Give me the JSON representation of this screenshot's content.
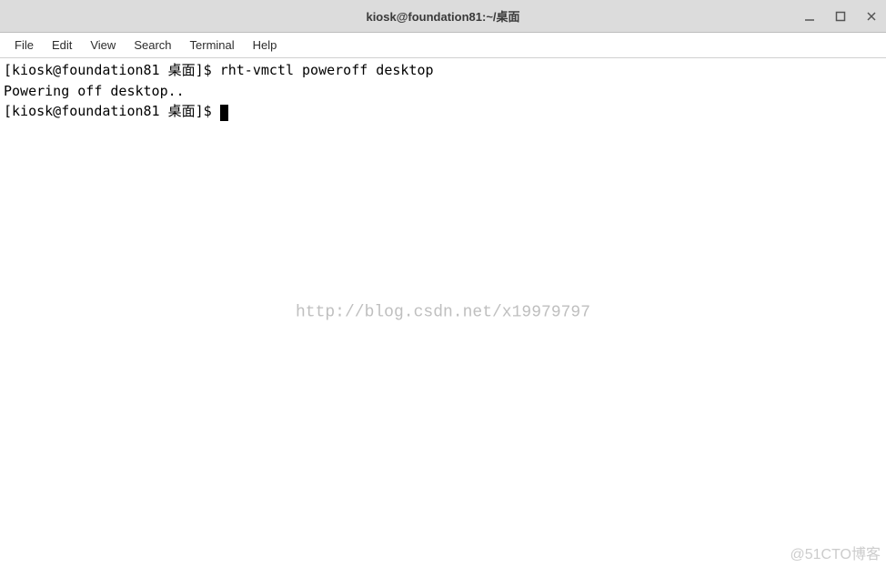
{
  "window": {
    "title": "kiosk@foundation81:~/桌面"
  },
  "menubar": {
    "file": "File",
    "edit": "Edit",
    "view": "View",
    "search": "Search",
    "terminal": "Terminal",
    "help": "Help"
  },
  "terminal": {
    "line1_prompt": "[kiosk@foundation81 桌面]$ ",
    "line1_cmd": "rht-vmctl poweroff desktop",
    "line2": "Powering off desktop..",
    "line3_prompt": "[kiosk@foundation81 桌面]$ "
  },
  "watermark": {
    "center": "http://blog.csdn.net/x19979797",
    "corner": "@51CTO博客"
  }
}
